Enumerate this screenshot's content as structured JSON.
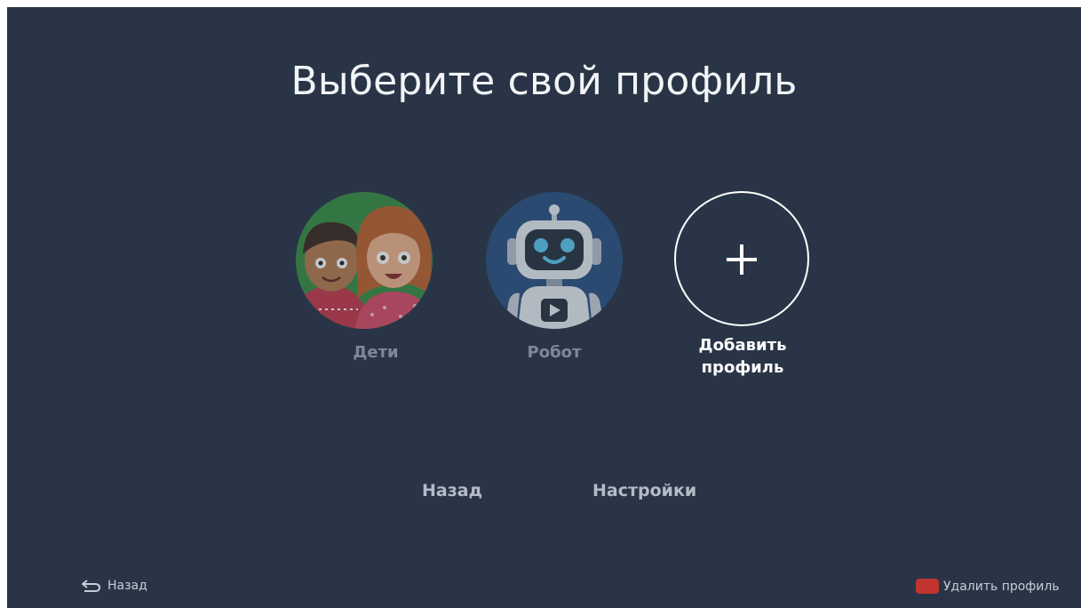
{
  "screen": {
    "title": "Выберите свой профиль",
    "background_color": "#293546"
  },
  "profiles": [
    {
      "label": "Дети",
      "avatar_icon": "kids-avatar-icon"
    },
    {
      "label": "Робот",
      "avatar_icon": "robot-avatar-icon"
    }
  ],
  "add_profile": {
    "label_line1": "Добавить",
    "label_line2": "профиль",
    "icon": "plus-icon"
  },
  "menu": {
    "back_label": "Назад",
    "settings_label": "Настройки"
  },
  "hints": {
    "back": {
      "icon": "return-arrow-icon",
      "label": "Назад"
    },
    "delete_profile": {
      "icon": "red-button-icon",
      "label": "Удалить профиль",
      "key_color": "#c2342f"
    }
  }
}
